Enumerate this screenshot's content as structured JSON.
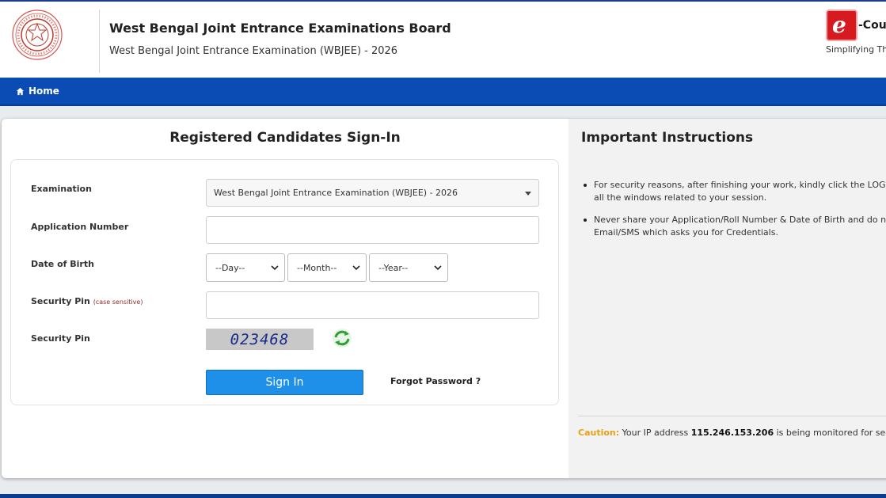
{
  "header": {
    "title": "West Bengal Joint Entrance Examinations Board",
    "subtitle": "West Bengal Joint Entrance Examination (WBJEE) - 2026",
    "brand_letter": "e",
    "brand_text": "-Coun",
    "brand_tagline": "Simplifying The"
  },
  "nav": {
    "home_label": "Home"
  },
  "form": {
    "title": "Registered Candidates Sign-In",
    "examination_label": "Examination",
    "examination_value": "West Bengal Joint Entrance Examination (WBJEE) - 2026",
    "application_label": "Application Number",
    "application_value": "",
    "dob_label": "Date of Birth",
    "day_placeholder": "--Day--",
    "month_placeholder": "--Month--",
    "year_placeholder": "--Year--",
    "security_pin_label": "Security Pin",
    "case_sensitive_note": "(case sensitive)",
    "security_pin_value": "",
    "captcha_label": "Security Pin",
    "captcha_text": "023468",
    "signin_label": "Sign In",
    "forgot_label": "Forgot Password ?"
  },
  "instructions": {
    "title": "Important Instructions",
    "items": [
      "For security reasons, after finishing your work, kindly click the LOGOUT\nall the windows related to your session.",
      "Never share your Application/Roll Number & Date of Birth and do not r\nEmail/SMS which asks you for Credentials."
    ],
    "caution_label": "Caution:",
    "caution_pre": " Your IP address ",
    "caution_ip": "115.246.153.206",
    "caution_post": " is being monitored for security p"
  },
  "colors": {
    "nav": "#0a4cb3",
    "signin": "#1e90ea",
    "caution": "#e6a118",
    "brand_red": "#d71920"
  }
}
